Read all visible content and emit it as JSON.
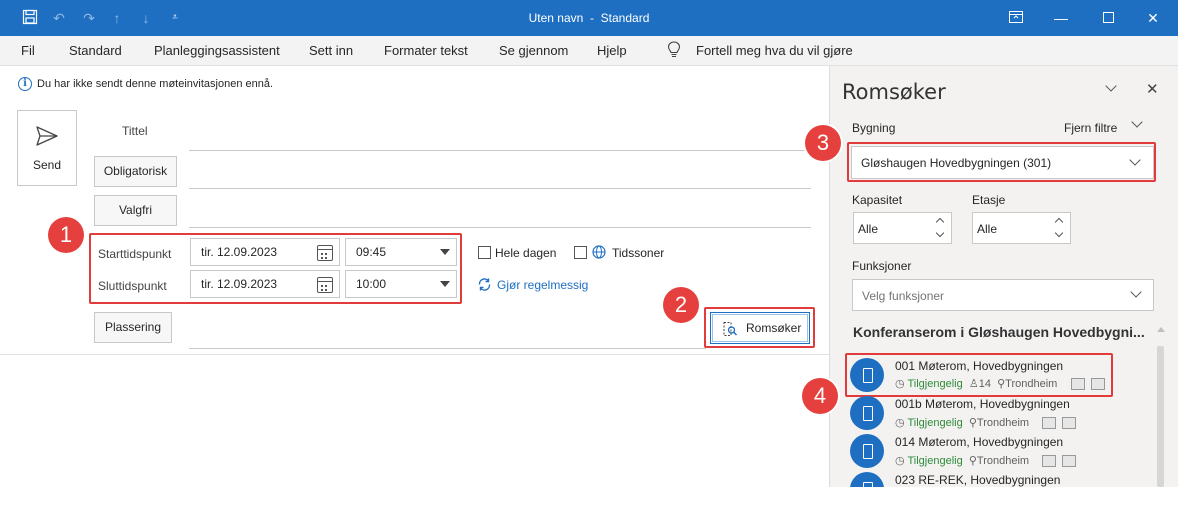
{
  "window": {
    "title": "Uten navn",
    "separator": "-",
    "profile": "Standard"
  },
  "menu": {
    "items": [
      "Fil",
      "Standard",
      "Planleggingsassistent",
      "Sett inn",
      "Formater tekst",
      "Se gjennom",
      "Hjelp"
    ],
    "tell_me": "Fortell meg hva du vil gjøre"
  },
  "info": {
    "text": "Du har ikke sendt denne møteinvitasjonen ennå."
  },
  "compose": {
    "send_label": "Send",
    "title_label": "Tittel",
    "required_label": "Obligatorisk",
    "optional_label": "Valgfri",
    "start_label": "Starttidspunkt",
    "end_label": "Sluttidspunkt",
    "start_date": "tir. 12.09.2023",
    "start_time": "09:45",
    "end_date": "tir. 12.09.2023",
    "end_time": "10:00",
    "all_day_label": "Hele dagen",
    "timezones_label": "Tidssoner",
    "recurring_label": "Gjør regelmessig",
    "location_label": "Plassering",
    "room_finder_label": "Romsøker"
  },
  "badges": [
    "1",
    "2",
    "3",
    "4"
  ],
  "panel": {
    "title": "Romsøker",
    "building_label": "Bygning",
    "clear_filters": "Fjern filtre",
    "building_value": "Gløshaugen Hovedbygningen (301)",
    "capacity_label": "Kapasitet",
    "capacity_value": "Alle",
    "floor_label": "Etasje",
    "floor_value": "Alle",
    "functions_label": "Funksjoner",
    "functions_placeholder": "Velg funksjoner",
    "section_title": "Konferanserom i Gløshaugen Hovedbygni...",
    "rooms": [
      {
        "name": "001 Møterom, Hovedbygningen",
        "status": "Tilgjengelig",
        "capacity": "14",
        "city": "Trondheim"
      },
      {
        "name": "001b Møterom, Hovedbygningen",
        "status": "Tilgjengelig",
        "city": "Trondheim"
      },
      {
        "name": "014 Møterom, Hovedbygningen",
        "status": "Tilgjengelig",
        "city": "Trondheim"
      },
      {
        "name": "023 RE-REK, Hovedbygningen"
      }
    ]
  },
  "colors": {
    "accent": "#1e6fc2",
    "highlight": "#e23b3b",
    "available": "#2e8b3a"
  }
}
